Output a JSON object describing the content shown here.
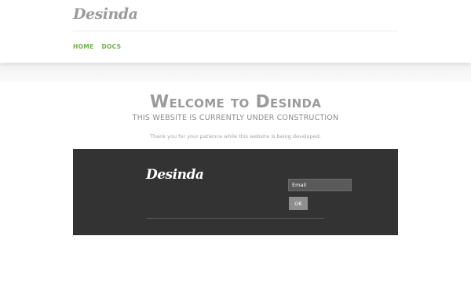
{
  "header": {
    "logo_text": "Desinda",
    "nav": [
      {
        "label": "HOME"
      },
      {
        "label": "DOCS"
      }
    ],
    "nav_color": "#6cb24a"
  },
  "main": {
    "title": "Welcome to Desinda",
    "subtitle": "THIS WEBSITE IS CURRENTLY UNDER CONSTRUCTION",
    "message": "Thank you for your patience while this website is being developed."
  },
  "footer": {
    "logo_text": "Desinda",
    "email_placeholder": "Email",
    "ok_label": "OK",
    "background": "#333333"
  }
}
